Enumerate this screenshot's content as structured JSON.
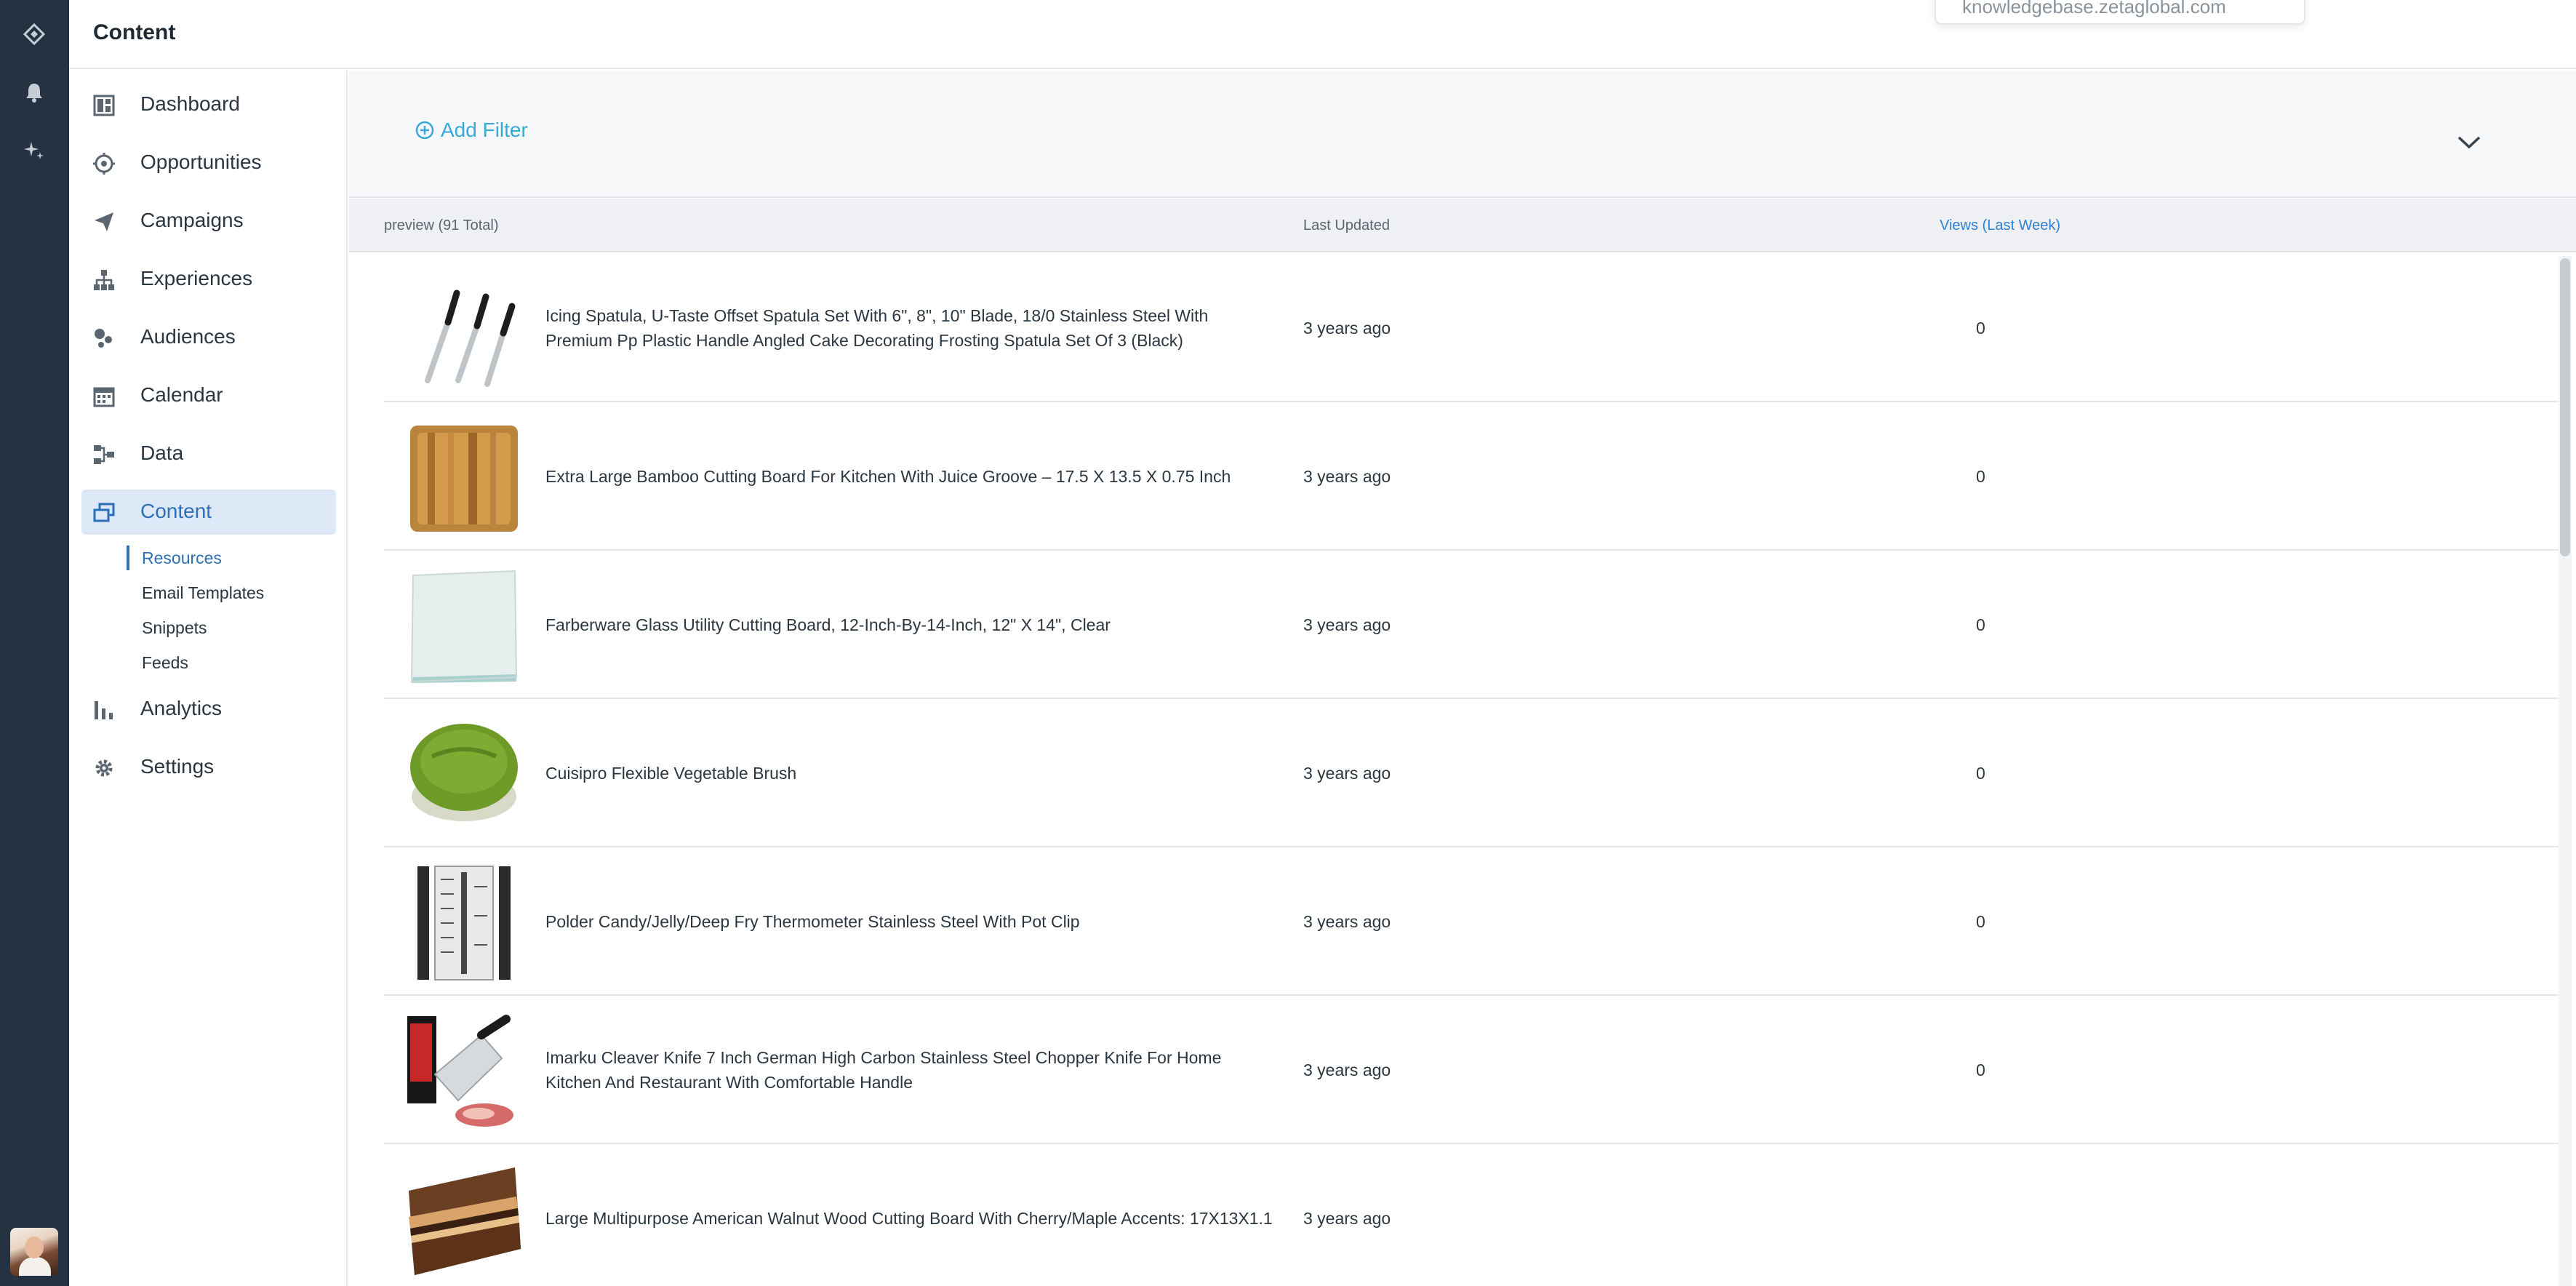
{
  "header": {
    "title": "Content",
    "dropdown_peek_text": "knowledgebase.zetaglobal.com"
  },
  "rail": {
    "icons": [
      "zeta-logo-icon",
      "bell-icon",
      "sparkle-icon"
    ],
    "avatar": "user-avatar"
  },
  "sidebar": {
    "items": [
      {
        "label": "Dashboard",
        "icon": "dashboard-icon"
      },
      {
        "label": "Opportunities",
        "icon": "target-icon"
      },
      {
        "label": "Campaigns",
        "icon": "paper-plane-icon"
      },
      {
        "label": "Experiences",
        "icon": "hierarchy-icon"
      },
      {
        "label": "Audiences",
        "icon": "audience-icon"
      },
      {
        "label": "Calendar",
        "icon": "calendar-icon"
      },
      {
        "label": "Data",
        "icon": "data-flow-icon"
      },
      {
        "label": "Content",
        "icon": "content-icon",
        "active": true
      },
      {
        "label": "Analytics",
        "icon": "bar-chart-icon"
      },
      {
        "label": "Settings",
        "icon": "gear-icon"
      }
    ],
    "content_sub": [
      {
        "label": "Resources",
        "active": true
      },
      {
        "label": "Email Templates"
      },
      {
        "label": "Snippets"
      },
      {
        "label": "Feeds"
      }
    ]
  },
  "filters": {
    "add_filter_label": "Add Filter"
  },
  "table": {
    "columns": {
      "preview": "preview (91 Total)",
      "last_updated": "Last Updated",
      "views": "Views (Last Week)"
    },
    "rows": [
      {
        "title": "Icing Spatula, U-Taste Offset Spatula Set With 6\", 8\", 10\" Blade, 18/0 Stainless Steel With Premium Pp Plastic Handle Angled Cake Decorating Frosting Spatula Set Of 3 (Black)",
        "updated": "3 years ago",
        "views": "0",
        "thumb": "spatula"
      },
      {
        "title": "Extra Large Bamboo Cutting Board For Kitchen With Juice Groove – 17.5 X 13.5 X 0.75 Inch",
        "updated": "3 years ago",
        "views": "0",
        "thumb": "bamboo"
      },
      {
        "title": "Farberware Glass Utility Cutting Board, 12-Inch-By-14-Inch, 12\" X 14\", Clear",
        "updated": "3 years ago",
        "views": "0",
        "thumb": "glass"
      },
      {
        "title": "Cuisipro Flexible Vegetable Brush",
        "updated": "3 years ago",
        "views": "0",
        "thumb": "brush"
      },
      {
        "title": "Polder Candy/Jelly/Deep Fry Thermometer Stainless Steel With Pot Clip",
        "updated": "3 years ago",
        "views": "0",
        "thumb": "thermometer"
      },
      {
        "title": "Imarku Cleaver Knife 7 Inch German High Carbon Stainless Steel Chopper Knife For Home Kitchen And Restaurant With Comfortable Handle",
        "updated": "3 years ago",
        "views": "0",
        "thumb": "cleaver"
      },
      {
        "title": "Large Multipurpose American Walnut Wood Cutting Board With Cherry/Maple Accents: 17X13X1.1",
        "updated": "3 years ago",
        "views": "",
        "thumb": "walnut"
      }
    ]
  },
  "colors": {
    "rail": "#253241",
    "accent": "#2d6fb7",
    "link": "#39a8d8",
    "active_bg": "#dde9f7"
  }
}
